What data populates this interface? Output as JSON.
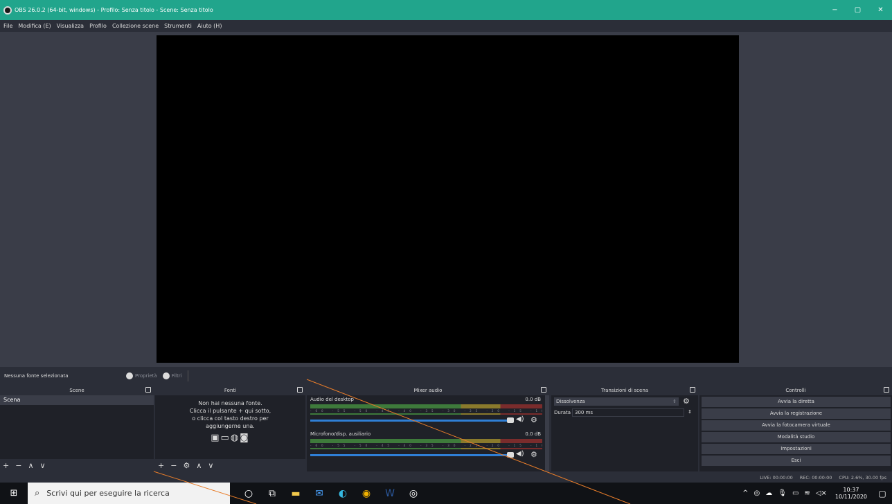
{
  "window": {
    "title": "OBS 26.0.2 (64-bit, windows) - Profilo: Senza titolo - Scene: Senza titolo",
    "controls": [
      "−",
      "▢",
      "✕"
    ]
  },
  "menu": [
    "File",
    "Modifica (E)",
    "Visualizza",
    "Profilo",
    "Collezione scene",
    "Strumenti",
    "Aiuto (H)"
  ],
  "source_bar": {
    "status": "Nessuna fonte selezionata",
    "properties_label": "Proprietà",
    "filters_label": "Filtri"
  },
  "scenes": {
    "header": "Scene",
    "items": [
      "Scena"
    ],
    "footer": [
      "+",
      "−",
      "∧",
      "∨"
    ]
  },
  "sources": {
    "header": "Fonti",
    "empty_lines": [
      "Non hai nessuna fonte.",
      "Clicca il pulsante + qui sotto,",
      "o clicca col tasto destro per",
      "aggiungerne una."
    ],
    "footer": [
      "+",
      "−",
      "⚙",
      "∧",
      "∨"
    ]
  },
  "mixer": {
    "header": "Mixer audio",
    "channels": [
      {
        "name": "Audio del desktop",
        "db": "0.0 dB"
      },
      {
        "name": "Microfono/disp. ausiliario",
        "db": "0.0 dB"
      }
    ],
    "ticks": "-60 -55 -50 -45 -40 -35 -30 -25 -20 -15 -10 -5 0"
  },
  "transitions": {
    "header": "Transizioni di scena",
    "selected": "Dissolvenza",
    "duration_label": "Durata",
    "duration_value": "300 ms"
  },
  "controls": {
    "header": "Controlli",
    "buttons": [
      "Avvia la diretta",
      "Avvia la registrazione",
      "Avvia la fotocamera virtuale",
      "Modalità studio",
      "Impostazioni",
      "Esci"
    ]
  },
  "status": {
    "live": "LIVE: 00:00:00",
    "rec": "REC: 00:00:00",
    "cpu": "CPU: 2.6%, 30.00 fps"
  },
  "taskbar": {
    "search_placeholder": "Scrivi qui per eseguire la ricerca",
    "time": "10:37",
    "date": "10/11/2020"
  },
  "colors": {
    "titlebar": "#21a58c",
    "background": "#2b2e38",
    "dock": "#1f2128",
    "accent": "#2f7fd6"
  }
}
